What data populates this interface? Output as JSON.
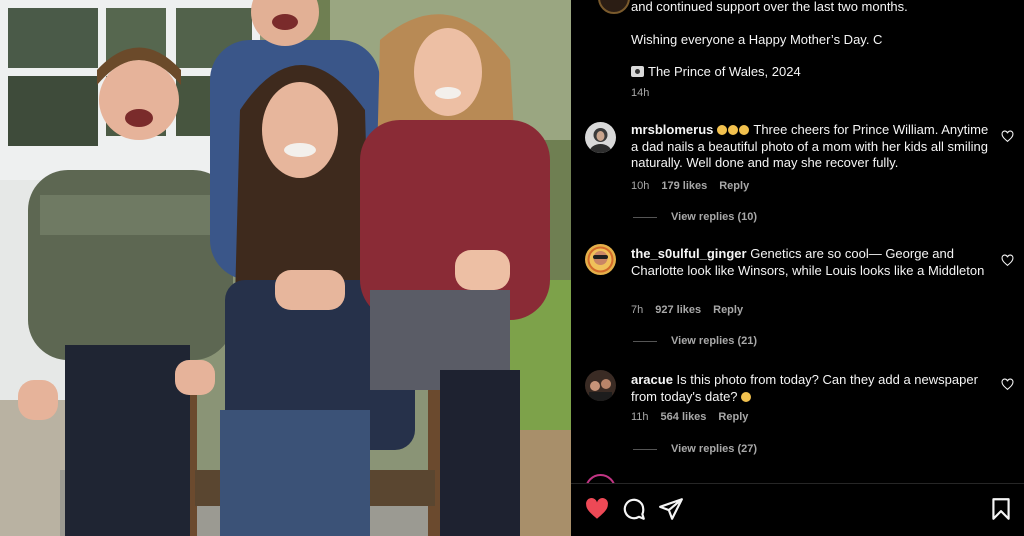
{
  "caption": {
    "line1": "and continued support over the last two months.",
    "line2": "Wishing everyone a Happy Mother’s Day. C",
    "line3": "The Prince of Wales, 2024",
    "time": "14h"
  },
  "comments": [
    {
      "user": "mrsblomerus",
      "text": "Three cheers for Prince William. Anytime a dad nails a beautiful photo of a mom with her kids all smiling naturally. Well done and may she recover fully.",
      "time": "10h",
      "likes": "179 likes",
      "reply": "Reply",
      "replies": "View replies (10)"
    },
    {
      "user": "the_s0ulful_ginger",
      "text": "Genetics are so cool— George and Charlotte look like Winsors, while Louis looks like a Middleton",
      "time": "7h",
      "likes": "927 likes",
      "reply": "Reply",
      "replies": "View replies (21)"
    },
    {
      "user": "aracue",
      "text": "Is this photo from today? Can they add a newspaper from today's date?",
      "time": "11h",
      "likes": "564 likes",
      "reply": "Reply",
      "replies": "View replies (27)"
    }
  ],
  "icons": {
    "like": "heart-icon",
    "comment": "comment-icon",
    "share": "send-icon",
    "save": "bookmark-icon"
  },
  "colors": {
    "like_active": "#ed4956",
    "text": "#f5f5f5",
    "muted": "#a8a8a8"
  }
}
